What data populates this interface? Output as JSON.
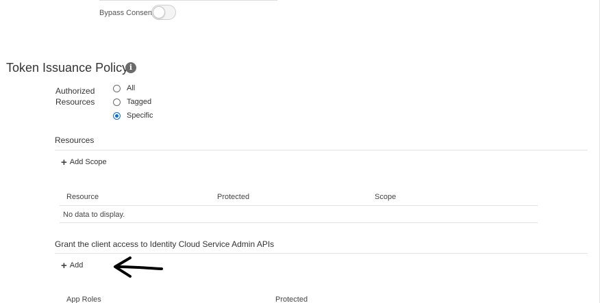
{
  "bypass_consent": {
    "label": "Bypass Consent",
    "enabled": false
  },
  "token_issuance_policy": {
    "title": "Token Issuance Policy",
    "info_icon": "info-icon",
    "authorized_resources": {
      "label": "Authorized Resources",
      "options": [
        {
          "label": "All",
          "checked": false
        },
        {
          "label": "Tagged",
          "checked": false
        },
        {
          "label": "Specific",
          "checked": true
        }
      ]
    }
  },
  "resources": {
    "heading": "Resources",
    "add_label": "Add Scope",
    "table": {
      "columns": [
        "Resource",
        "Protected",
        "Scope"
      ],
      "empty_text": "No data to display."
    }
  },
  "admin_apis": {
    "heading": "Grant the client access to Identity Cloud Service Admin APIs",
    "add_label": "Add",
    "table": {
      "columns": [
        "App Roles",
        "Protected"
      ]
    }
  },
  "colors": {
    "accent": "#0b6fd1",
    "annotation_arrow": "#000000"
  }
}
